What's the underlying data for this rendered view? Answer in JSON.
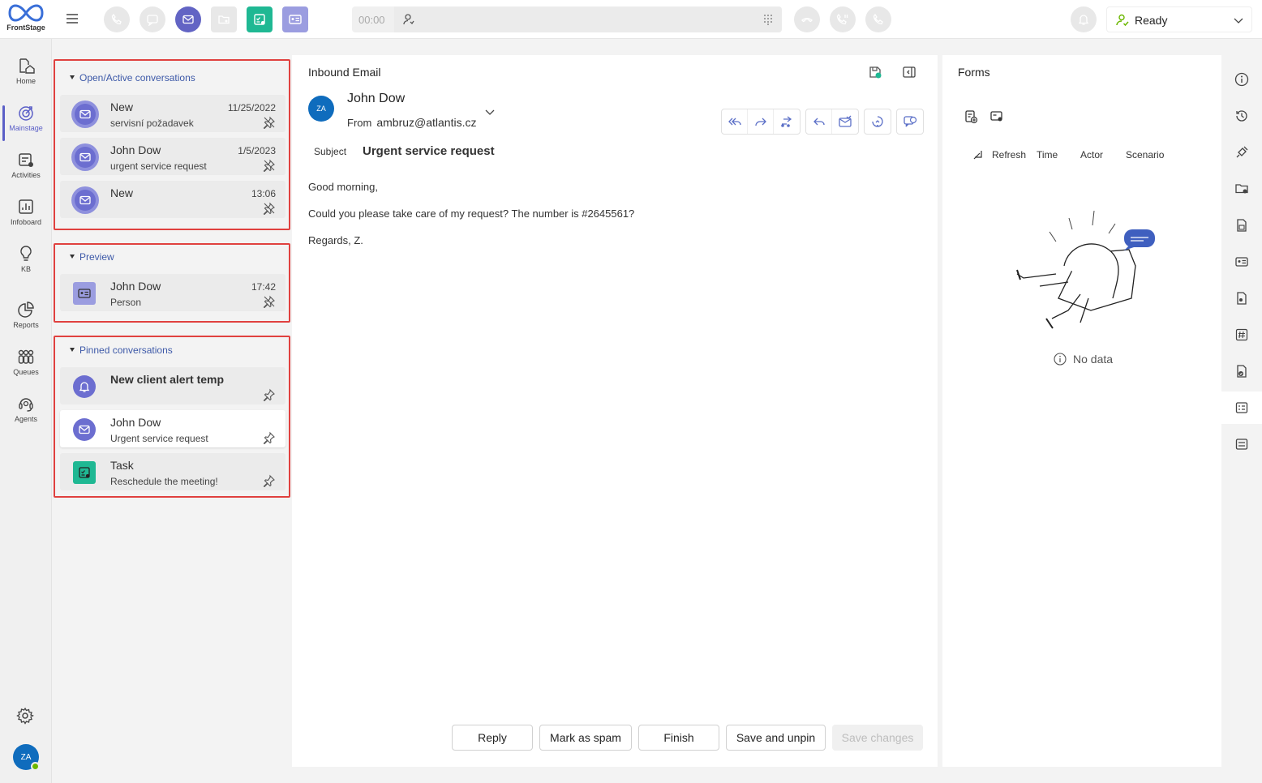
{
  "app": {
    "logo_text": "FrontStage"
  },
  "topbar": {
    "call_time": "00:00",
    "status": "Ready",
    "status_color": "#6bb700"
  },
  "nav": {
    "items": [
      {
        "label": "Home",
        "icon": "home-icon"
      },
      {
        "label": "Mainstage",
        "icon": "target-icon"
      },
      {
        "label": "Activities",
        "icon": "activities-icon"
      },
      {
        "label": "Infoboard",
        "icon": "chart-icon"
      },
      {
        "label": "KB",
        "icon": "lightbulb-icon"
      },
      {
        "label": "Reports",
        "icon": "pie-icon"
      },
      {
        "label": "Queues",
        "icon": "queues-icon"
      },
      {
        "label": "Agents",
        "icon": "headset-icon"
      }
    ],
    "user_initials": "ZA"
  },
  "sections": {
    "open": {
      "title": "Open/Active conversations",
      "items": [
        {
          "title": "New",
          "subtitle": "servisní požadavek",
          "date": "11/25/2022"
        },
        {
          "title": "John Dow",
          "subtitle": "urgent service request",
          "date": "1/5/2023"
        },
        {
          "title": "New",
          "subtitle": "",
          "date": "13:06"
        }
      ]
    },
    "preview": {
      "title": "Preview",
      "items": [
        {
          "title": "John Dow",
          "subtitle": "Person",
          "date": "17:42"
        }
      ]
    },
    "pinned": {
      "title": "Pinned conversations",
      "items": [
        {
          "title": "New client alert temp",
          "subtitle": ""
        },
        {
          "title": "John Dow",
          "subtitle": "Urgent service request"
        },
        {
          "title": "Task",
          "subtitle": "Reschedule the meeting!"
        }
      ]
    }
  },
  "email": {
    "header": "Inbound Email",
    "avatar": "ZA",
    "sender": "John Dow",
    "from_label": "From",
    "from_address": "ambruz@atlantis.cz",
    "subject_label": "Subject",
    "subject": "Urgent service request",
    "body": [
      "Good morning,",
      "Could you please take care of my request? The number is #2645561?",
      "Regards, Z."
    ],
    "buttons": {
      "reply": "Reply",
      "spam": "Mark as spam",
      "finish": "Finish",
      "save_unpin": "Save and unpin",
      "save_changes": "Save changes"
    }
  },
  "forms": {
    "title": "Forms",
    "refresh": "Refresh",
    "columns": [
      "Time",
      "Actor",
      "Scenario"
    ],
    "empty": "No data"
  },
  "colors": {
    "accent": "#5b5fc7",
    "task": "#1fb893",
    "highlight": "#e0413f",
    "link": "#3d59a8"
  }
}
